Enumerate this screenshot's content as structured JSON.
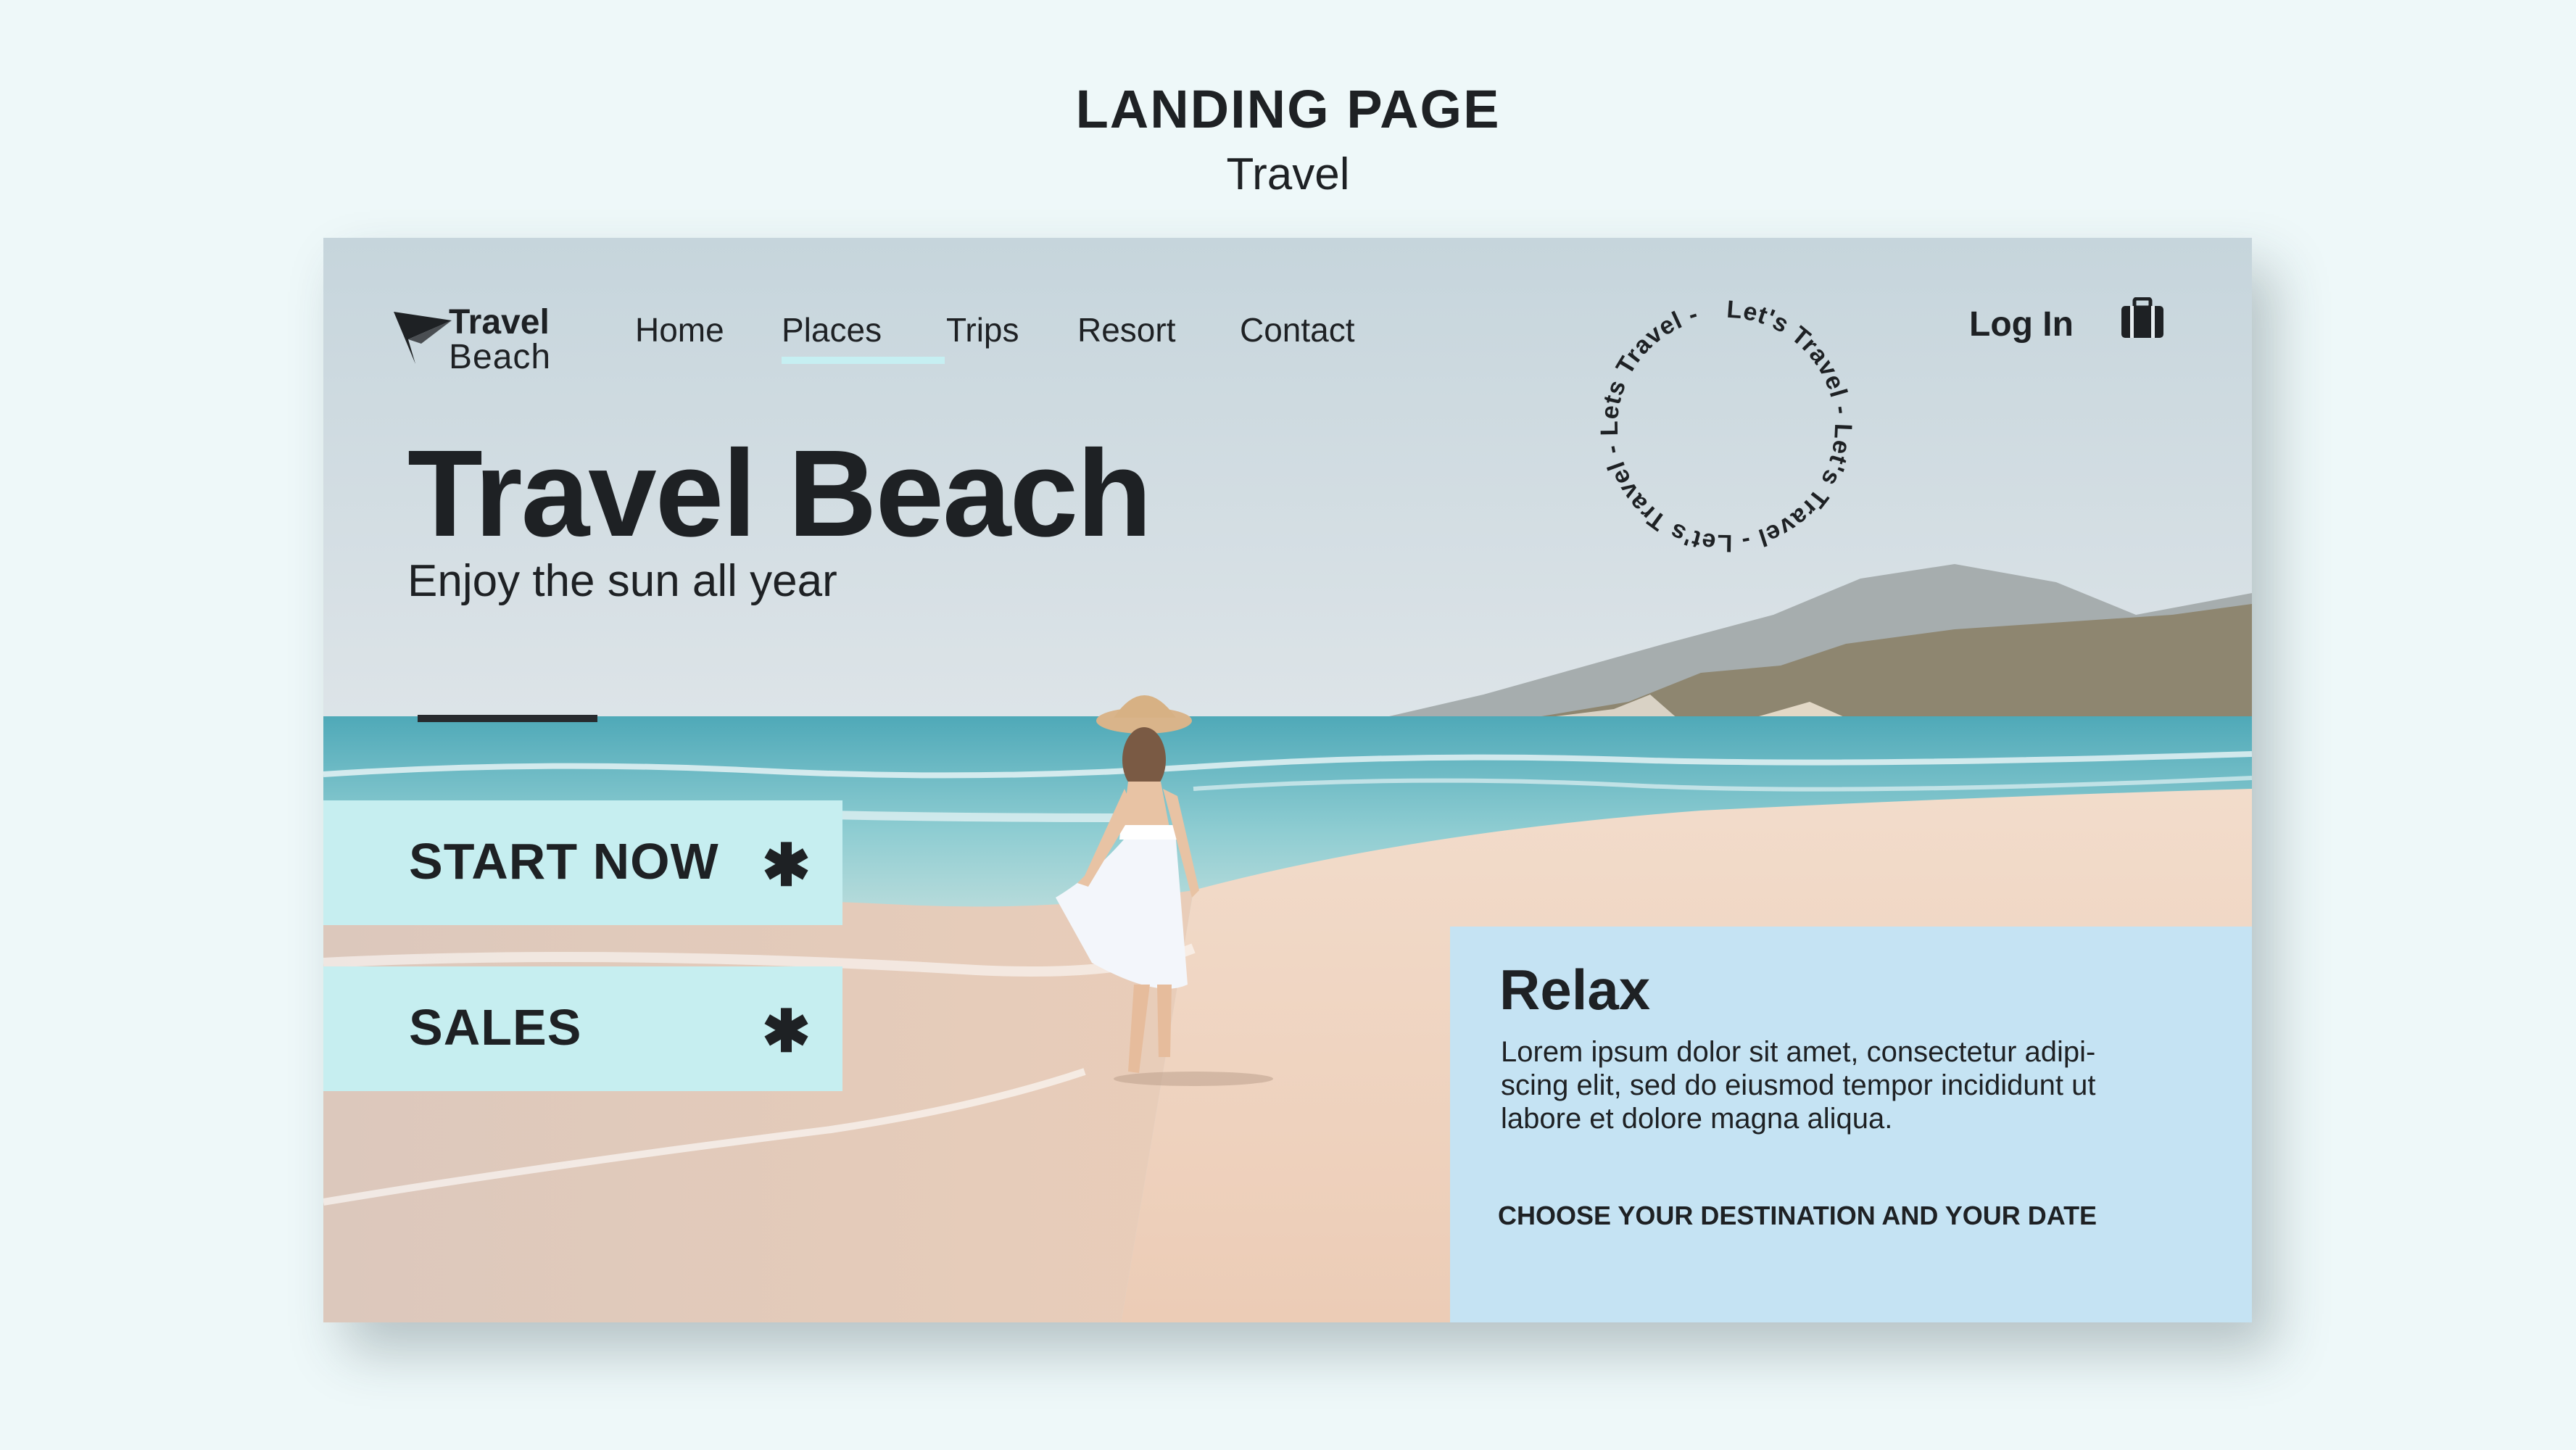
{
  "page": {
    "title": "LANDING PAGE",
    "subtitle": "Travel"
  },
  "logo": {
    "line1": "Travel",
    "line2": "Beach",
    "icon": "paper-plane-icon"
  },
  "nav": {
    "items": [
      "Home",
      "Places",
      "Trips",
      "Resort",
      "Contact"
    ],
    "active": "Places",
    "login": "Log In",
    "bag_icon": "briefcase-icon"
  },
  "badge": {
    "text": "Let's Travel - Let's Travel - Let's Travel - Lets Travel - "
  },
  "hero": {
    "title": "Travel Beach",
    "subtitle": "Enjoy the sun all year"
  },
  "cta": {
    "primary": "START NOW",
    "secondary": "SALES",
    "icon": "asterisk-icon"
  },
  "info": {
    "title": "Relax",
    "body_lines": [
      "Lorem ipsum dolor sit amet, consectetur adipi-",
      "scing elit, sed do eiusmod tempor incididunt ut",
      "labore et dolore magna aliqua."
    ],
    "cta": "CHOOSE YOUR DESTINATION AND YOUR DATE"
  },
  "colors": {
    "background": "#eef8f9",
    "text": "#1e2124",
    "cta_bg": "#c6eef0",
    "card_bg": "#c5e3f3",
    "active_underline": "#c6eff2",
    "sky": "#cfdbe2",
    "sea": "#7fc4cc",
    "sand": "#efd3bf"
  }
}
